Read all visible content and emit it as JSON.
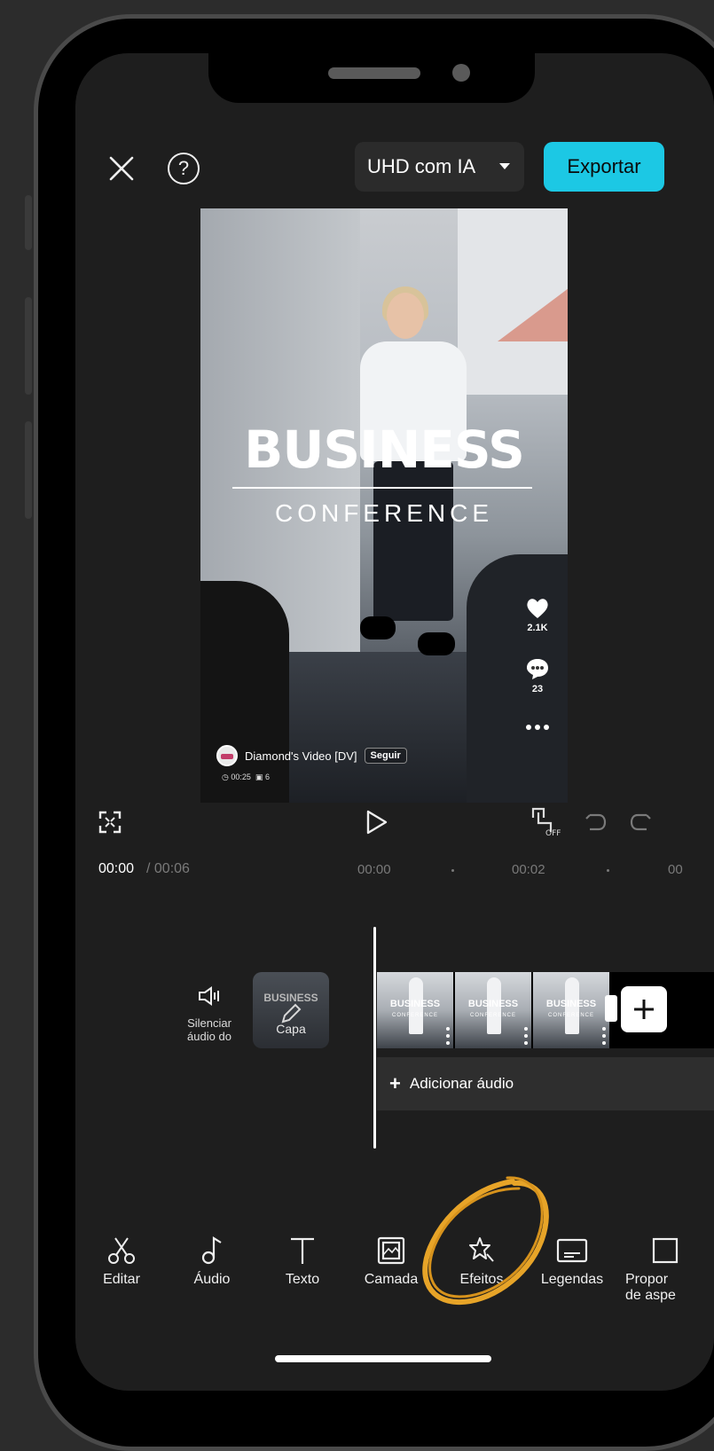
{
  "header": {
    "quality_label": "UHD com IA",
    "export_label": "Exportar"
  },
  "preview": {
    "title_main": "BUSINESS",
    "title_sub": "CONFERENCE",
    "likes": "2.1K",
    "comments": "23",
    "author": "Diamond's Video [DV]",
    "follow": "Seguir",
    "duration": "00:25",
    "count": "6"
  },
  "playback": {
    "current_time": "00:00",
    "total_time": "/ 00:06",
    "ruler": [
      "00:00",
      "00:02",
      "00"
    ]
  },
  "timeline": {
    "mute_label_line1": "Silenciar",
    "mute_label_line2": "áudio do",
    "cover_label": "Capa",
    "cover_text": "BUSINESS",
    "clip_title": "BUSINESS",
    "clip_subtitle": "CONFERENCE",
    "add_audio": "Adicionar áudio"
  },
  "toolbar": {
    "items": [
      {
        "label": "Editar",
        "icon": "scissors-icon"
      },
      {
        "label": "Áudio",
        "icon": "music-note-icon"
      },
      {
        "label": "Texto",
        "icon": "text-icon"
      },
      {
        "label": "Camada",
        "icon": "overlay-icon"
      },
      {
        "label": "Efeitos",
        "icon": "effects-star-icon"
      },
      {
        "label": "Legendas",
        "icon": "captions-icon"
      },
      {
        "label": "Propor",
        "label2": "de aspe",
        "icon": "aspect-ratio-icon"
      }
    ]
  },
  "colors": {
    "accent": "#1cc8e4",
    "highlight_scribble": "#e7a428",
    "background": "#1e1e1e"
  }
}
